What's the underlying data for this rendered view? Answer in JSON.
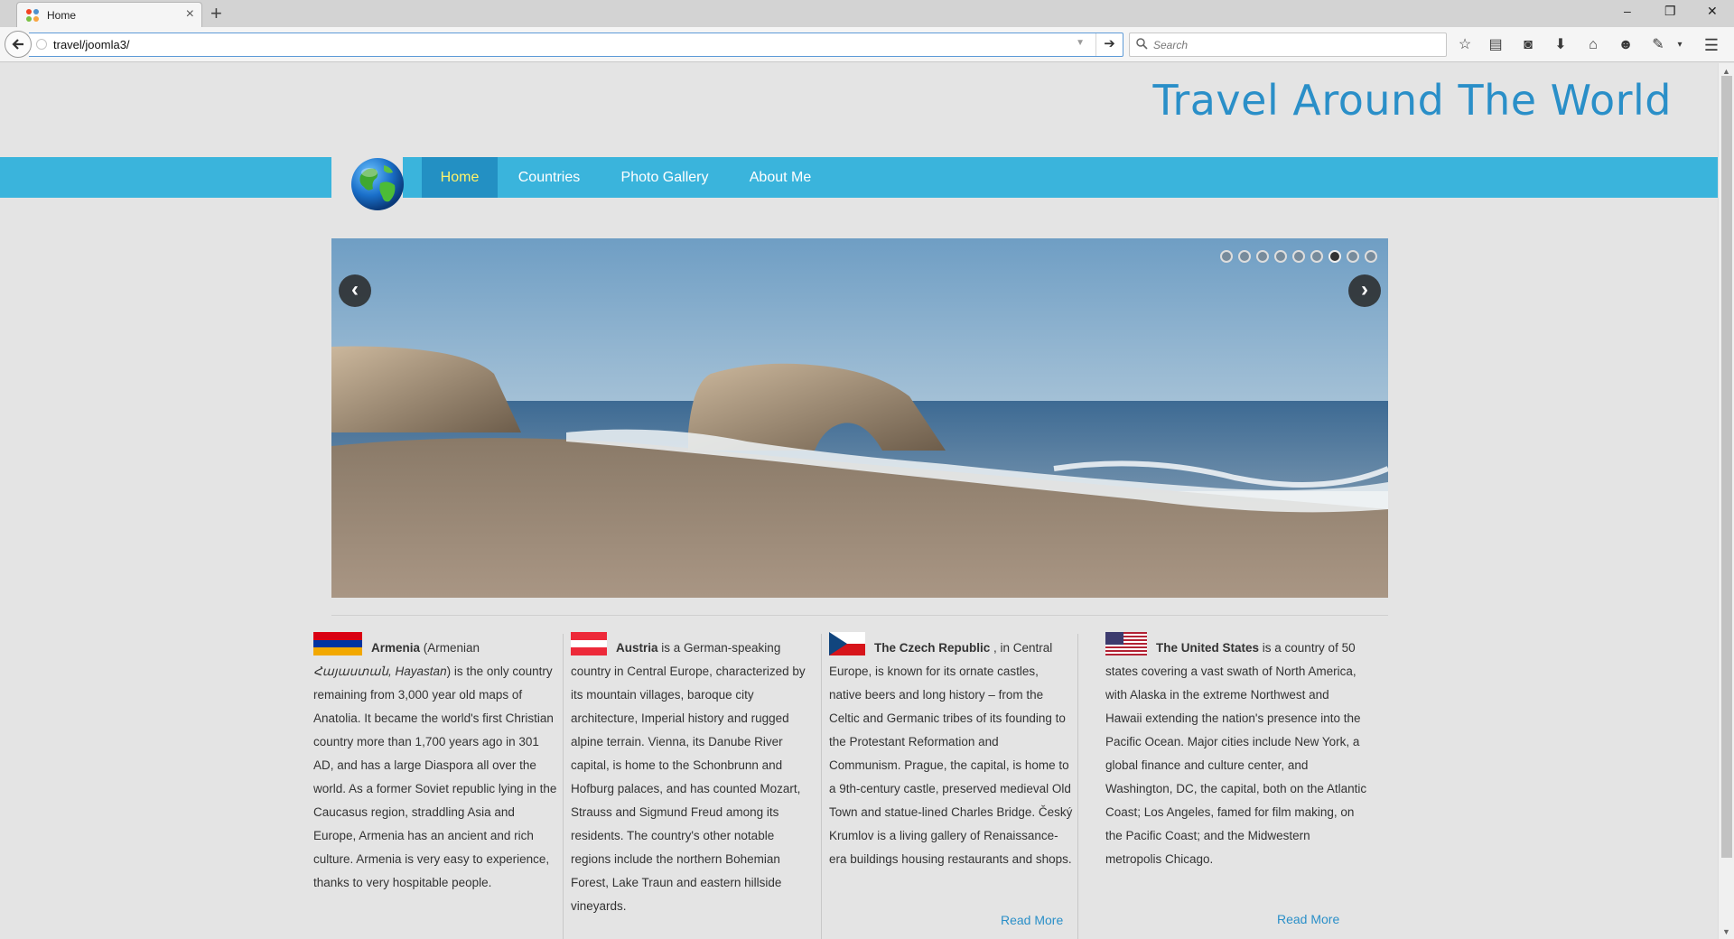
{
  "browser": {
    "tab_title": "Home",
    "new_tab": "+",
    "close_tab": "×",
    "url": "travel/joomla3/",
    "search_placeholder": "Search",
    "window_controls": {
      "minimize": "–",
      "restore": "❐",
      "close": "✕"
    }
  },
  "site": {
    "title": "Travel Around The World",
    "menu": [
      {
        "label": "Home",
        "active": true
      },
      {
        "label": "Countries",
        "active": false
      },
      {
        "label": "Photo Gallery",
        "active": false
      },
      {
        "label": "About Me",
        "active": false
      }
    ]
  },
  "slider": {
    "slide_count": 9,
    "active_index": 7,
    "prev": "‹",
    "next": "›"
  },
  "articles": [
    {
      "name": "Armenia",
      "flag": "armenia-flag",
      "text_a": " (Armenian ",
      "native": "Հայաստան, Hayastan",
      "text_b": ") is the only country remaining from 3,000 year old maps of Anatolia. It became the world's first Christian country more than 1,700 years ago in 301 AD, and has a large Diaspora all over the world. As a former Soviet republic lying in the Caucasus region, straddling Asia and Europe, Armenia has an ancient and rich culture. Armenia is very easy to experience, thanks to very hospitable people."
    },
    {
      "name": "Austria",
      "flag": "austria-flag",
      "text": " is a German-speaking country in Central Europe, characterized by its mountain villages, baroque city architecture, Imperial history and rugged alpine terrain. Vienna, its Danube River capital, is home to the Schonbrunn and Hofburg palaces, and has counted Mozart, Strauss and Sigmund Freud among its residents. The country's other notable regions include the northern Bohemian Forest, Lake Traun and eastern hillside vineyards."
    },
    {
      "name": "The Czech Republic",
      "flag": "czech-flag",
      "text": " , in Central Europe, is known for its ornate castles, native beers and long history – from the Celtic and Germanic tribes of its founding to the Protestant Reformation and Communism. Prague, the capital, is home to a 9th-century castle, preserved medieval Old Town and statue-lined Charles Bridge. Český Krumlov is a living gallery of Renaissance-era buildings housing restaurants and shops.",
      "read_more": "Read More"
    },
    {
      "name": "The United States",
      "flag": "us-flag",
      "text": " is a country of 50 states covering a vast swath of North America, with Alaska in the extreme Northwest and Hawaii extending the nation's presence into the Pacific Ocean. Major cities include New York, a global finance and culture center, and Washington, DC, the capital, both on the Atlantic Coast; Los Angeles, famed for film making, on the Pacific Coast; and the Midwestern metropolis Chicago.",
      "read_more": "Read More"
    }
  ]
}
